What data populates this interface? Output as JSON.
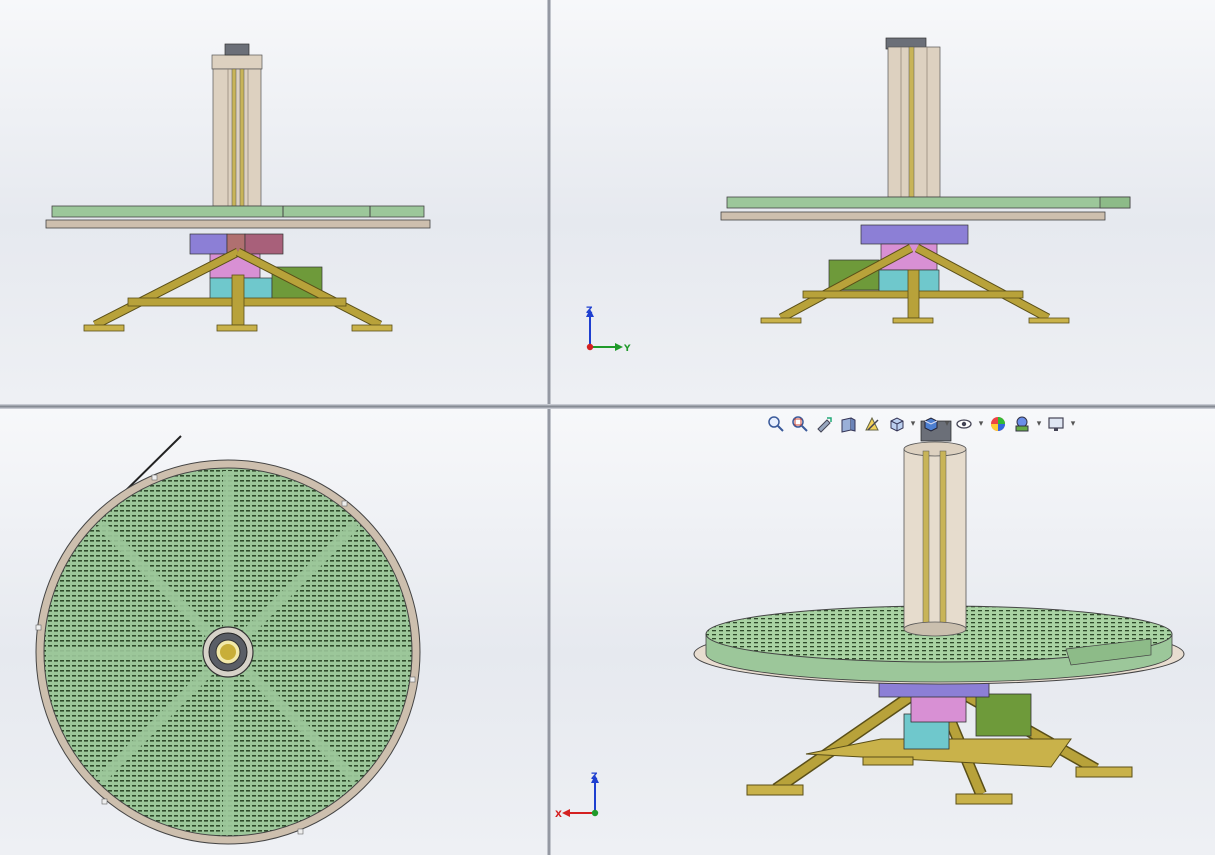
{
  "viewports": [
    {
      "name": "front",
      "triad": null
    },
    {
      "name": "right",
      "triad": {
        "up": "Z",
        "side": "Y"
      }
    },
    {
      "name": "top",
      "triad": null
    },
    {
      "name": "isometric",
      "triad": {
        "up": "Z",
        "side": "X"
      }
    }
  ],
  "heads_up_toolbar": {
    "icons": [
      "zoom-to-fit-icon",
      "zoom-to-area-icon",
      "previous-view-icon",
      "section-view-icon",
      "dynamic-annotation-icon",
      "view-orientation-icon",
      "display-style-icon",
      "hide-show-items-icon",
      "edit-appearance-icon",
      "apply-scene-icon",
      "view-settings-icon"
    ]
  },
  "colors": {
    "platter_green": "#9cc79a",
    "platter_dark": "#2e4a2a",
    "rim_tan": "#cdbfae",
    "column": "#ddd1c0",
    "frame_yellow": "#b8a23a",
    "block_purple": "#8c7fd6",
    "block_pink": "#d890d4",
    "block_cyan": "#6fc8cc",
    "motor_green": "#6e9a3a",
    "axis_z": "#1e3fd0",
    "axis_y": "#1f9a2a",
    "axis_x": "#d42020"
  }
}
